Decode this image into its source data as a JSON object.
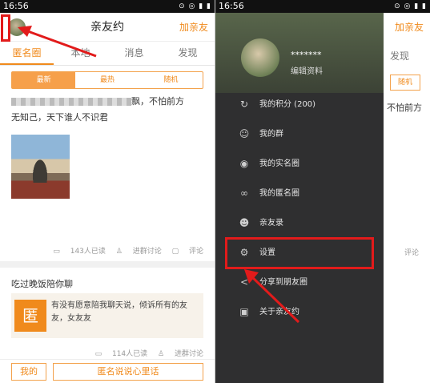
{
  "status": {
    "time": "16:56",
    "icons": "⊙ ◎ ▮ ▮"
  },
  "app": {
    "title": "亲友约",
    "add_friend": "加亲友"
  },
  "tabs": [
    "匿名圈",
    "本地",
    "消息",
    "发现"
  ],
  "filters": [
    "最新",
    "最热",
    "随机"
  ],
  "post1": {
    "text_tail": "飘，不怕前方",
    "text_line2": "无知己，天下谁人不识君",
    "readers": "143人已读",
    "discuss": "进群讨论",
    "comment": "评论"
  },
  "post2": {
    "title": "吃过晚饭陪你聊",
    "badge": "匿",
    "text": "有没有愿意陪我聊天说，倾诉所有的友友，女友友",
    "readers": "114人已读",
    "discuss": "进群讨论"
  },
  "bottom": {
    "mine": "我的",
    "say": "匿名说说心里话"
  },
  "drawer": {
    "username": "*******",
    "edit_profile": "编辑资料",
    "items": [
      {
        "icon": "↻",
        "label": "我的积分 (200)"
      },
      {
        "icon": "☺",
        "label": "我的群"
      },
      {
        "icon": "◉",
        "label": "我的实名圈"
      },
      {
        "icon": "∞",
        "label": "我的匿名圈"
      },
      {
        "icon": "☻",
        "label": "亲友录"
      },
      {
        "icon": "⚙",
        "label": "设置"
      },
      {
        "icon": "<",
        "label": "分享到朋友圈"
      },
      {
        "icon": "▣",
        "label": "关于亲友约"
      }
    ]
  },
  "background": {
    "tab": "发现",
    "filter": "随机",
    "text": "不怕前方",
    "comment": "评论"
  },
  "colors": {
    "accent": "#f08a1c",
    "highlight": "#e21b1b"
  }
}
